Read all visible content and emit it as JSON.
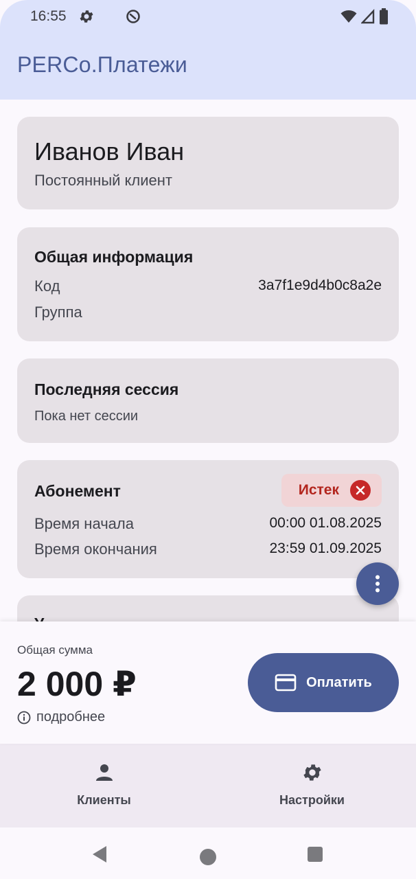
{
  "status_bar": {
    "time": "16:55"
  },
  "app_bar": {
    "title": "PERCo.Платежи"
  },
  "profile": {
    "name": "Иванов Иван",
    "type": "Постоянный клиент"
  },
  "general_info": {
    "title": "Общая информация",
    "code_label": "Код",
    "code_value": "3a7f1e9d4b0c8a2e",
    "group_label": "Группа",
    "group_value": ""
  },
  "last_session": {
    "title": "Последняя сессия",
    "empty_text": "Пока нет сессии"
  },
  "subscription": {
    "title": "Абонемент",
    "status": "Истек",
    "start_label": "Время начала",
    "start_value": "00:00 01.08.2025",
    "end_label": "Время окончания",
    "end_value": "23:59 01.09.2025"
  },
  "extra_card": {
    "title": "У"
  },
  "payment": {
    "total_label": "Общая сумма",
    "total_value": "2 000 ₽",
    "details_label": "подробнее",
    "pay_label": "Оплатить"
  },
  "bottom_nav": {
    "items": [
      {
        "label": "Клиенты",
        "icon": "person-icon"
      },
      {
        "label": "Настройки",
        "icon": "gear-icon"
      }
    ]
  },
  "colors": {
    "primary": "#4a5c96",
    "top_bar": "#dce2fb",
    "card": "#e6e1e6",
    "error": "#c62828",
    "error_container": "#f1d4d6"
  }
}
